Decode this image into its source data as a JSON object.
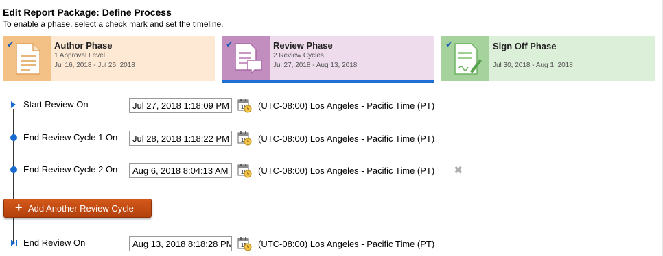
{
  "page": {
    "title": "Edit Report Package: Define Process",
    "subtitle": "To enable a phase, select a check mark and set the timeline."
  },
  "phases": [
    {
      "name": "Author Phase",
      "detail": "1 Approval Level",
      "dates": "Jul 16, 2018 - Jul 26, 2018",
      "checked": true,
      "selected": false
    },
    {
      "name": "Review Phase",
      "detail": "2 Review Cycles",
      "dates": "Jul 27, 2018 - Aug 13, 2018",
      "checked": true,
      "selected": true
    },
    {
      "name": "Sign Off Phase",
      "detail": "",
      "dates": "Jul 30, 2018 - Aug 1, 2018",
      "checked": true,
      "selected": false
    }
  ],
  "check_glyph": "✔",
  "timeline": {
    "rows": [
      {
        "label": "Start Review On",
        "value": "Jul 27, 2018 1:18:09 PM",
        "timezone": "(UTC-08:00) Los Angeles - Pacific Time (PT)"
      },
      {
        "label": "End Review Cycle 1 On",
        "value": "Jul 28, 2018 1:18:22 PM",
        "timezone": "(UTC-08:00) Los Angeles - Pacific Time (PT)"
      },
      {
        "label": "End Review Cycle 2 On",
        "value": "Aug 6, 2018 8:04:13 AM",
        "timezone": "(UTC-08:00) Los Angeles - Pacific Time (PT)"
      },
      {
        "label": "End Review On",
        "value": "Aug 13, 2018 8:18:28 PM",
        "timezone": "(UTC-08:00) Los Angeles - Pacific Time (PT)"
      }
    ],
    "add_button_label": "Add Another Review Cycle",
    "add_button_icon": "+",
    "remove_glyph": "✖"
  },
  "colors": {
    "accent_blue": "#1a6bd1",
    "author_bg": "#fde9d4",
    "review_bg": "#eedcec",
    "signoff_bg": "#dcefd9",
    "add_button": "#c24e14"
  }
}
